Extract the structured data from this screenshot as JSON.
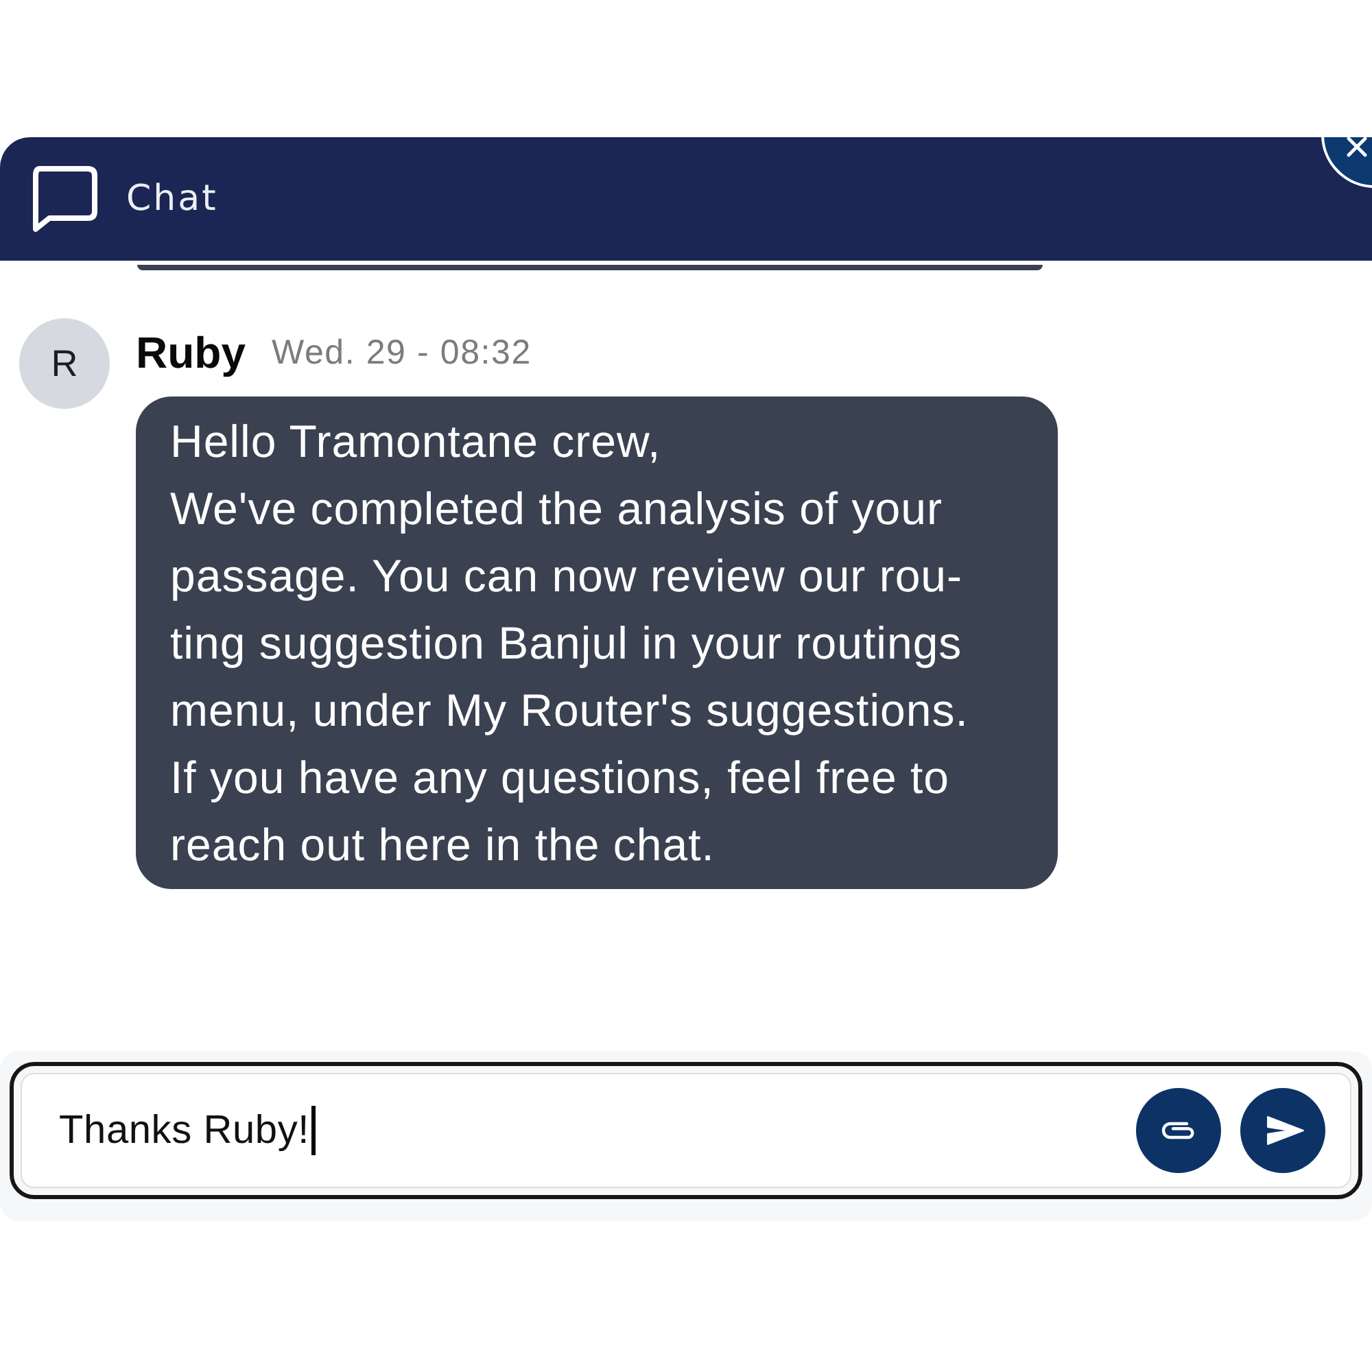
{
  "header": {
    "title": "Chat"
  },
  "messages": [
    {
      "author": "Ruby",
      "avatar_initial": "R",
      "time": "Wed. 29 - 08:32",
      "text": "Hello Tramontane crew,\nWe've completed the analysis of your\npassage. You can now review our rou-\nting suggestion Banjul in your routings\nmenu, under My Router's suggestions.\nIf you have any questions, feel free to\nreach out here in the chat."
    }
  ],
  "composer": {
    "value": "Thanks Ruby!",
    "focused": true
  }
}
